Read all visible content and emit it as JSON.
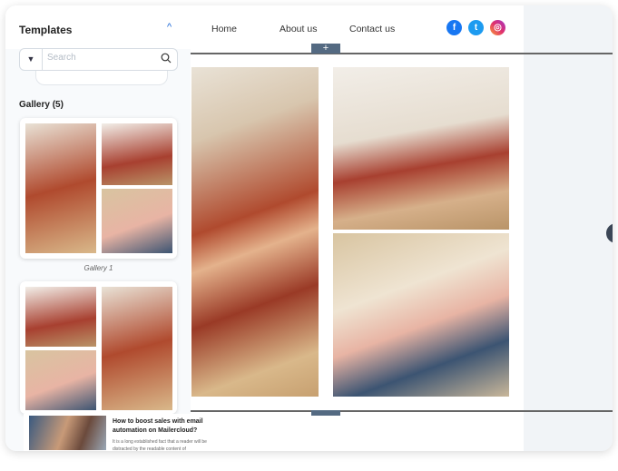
{
  "sidebar": {
    "title": "Templates",
    "search": {
      "placeholder": "Search",
      "value": ""
    },
    "gallery_title": "Gallery (5)",
    "galleries": [
      {
        "label": "Gallery 1"
      }
    ],
    "blog": {
      "title": "How to boost sales with email automation on Mailercloud?",
      "excerpt": "It is a long established fact that a reader will be distracted by the readable content of"
    }
  },
  "header": {
    "nav": [
      "Home",
      "About us",
      "Contact us"
    ],
    "social": [
      {
        "icon": "facebook-icon",
        "color": "#1877f2"
      },
      {
        "icon": "twitter-icon",
        "color": "#1d9bf0"
      },
      {
        "icon": "instagram-icon",
        "color": "#e1306c"
      }
    ]
  },
  "icons": {
    "plus": "+",
    "chevron": "^",
    "filter": "▼",
    "fb": "f",
    "tw": "t",
    "ig": "◎"
  }
}
